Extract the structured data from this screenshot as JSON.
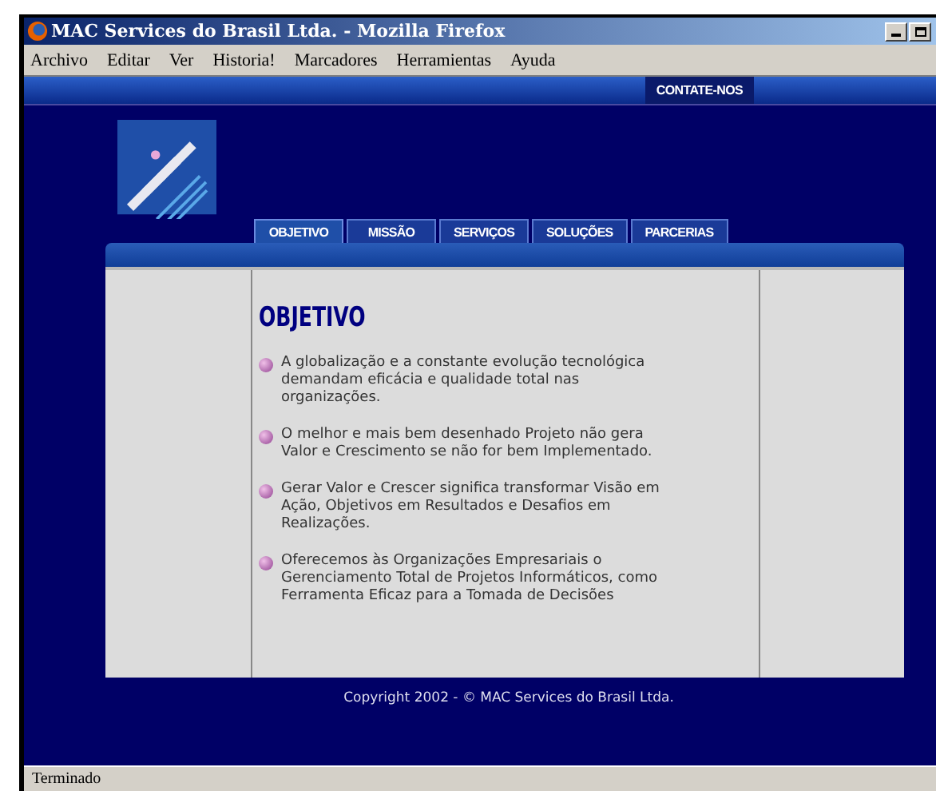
{
  "window": {
    "title": "MAC Services do Brasil Ltda. - Mozilla Firefox"
  },
  "menu": [
    "Archivo",
    "Editar",
    "Ver",
    "Historia!",
    "Marcadores",
    "Herramientas",
    "Ayuda"
  ],
  "header": {
    "contact_button": "CONTATE-NOS"
  },
  "tabs": [
    {
      "label": "OBJETIVO",
      "selected": true
    },
    {
      "label": "MISSÃO",
      "selected": false
    },
    {
      "label": "SERVIÇOS",
      "selected": false
    },
    {
      "label": "SOLUÇÕES",
      "selected": false
    },
    {
      "label": "PARCERIAS",
      "selected": false
    }
  ],
  "content": {
    "heading": "OBJETIVO",
    "bullets": [
      "A globalização e a constante evolução tecnológica demandam eficácia e qualidade total nas organizações.",
      "O melhor e mais bem desenhado Projeto não gera Valor e Crescimento se não for bem Implementado.",
      "Gerar Valor e Crescer significa transformar Visão em Ação, Objetivos em Resultados e Desafios em Realizações.",
      "Oferecemos às Organizações Empresariais o Gerenciamento Total de Projetos Informáticos, como Ferramenta Eficaz para a Tomada de Decisões"
    ]
  },
  "footer": "Copyright 2002 - © MAC Services do Brasil Ltda.",
  "status_bar": "Terminado"
}
